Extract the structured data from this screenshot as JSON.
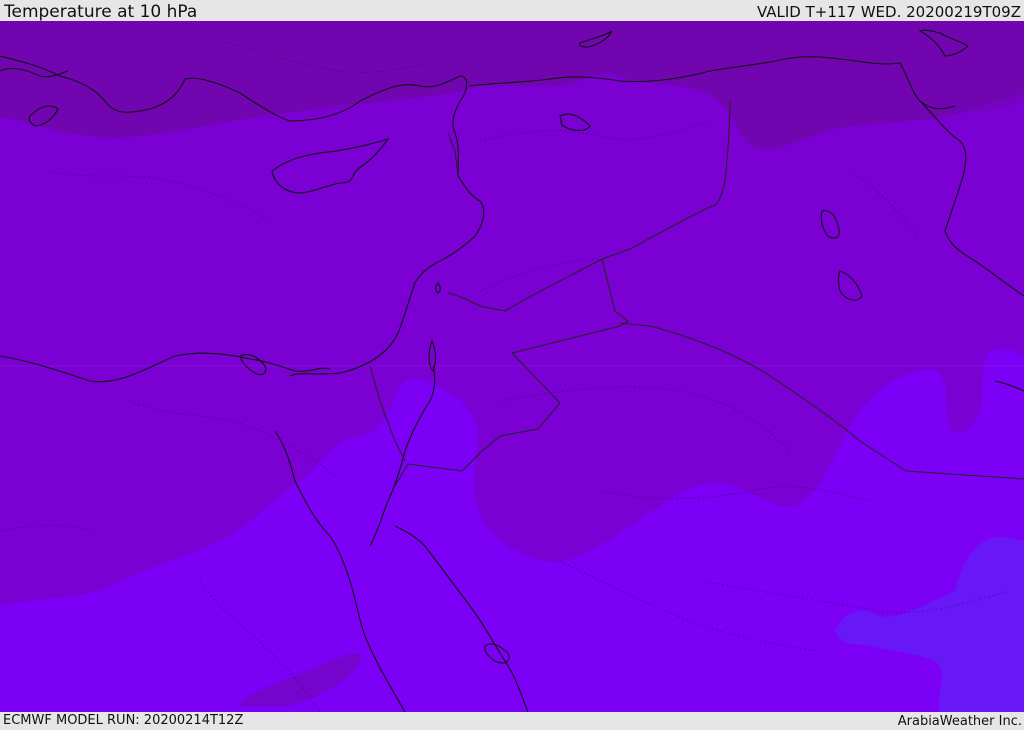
{
  "header": {
    "title": "Temperature at 10 hPa",
    "valid": "VALID T+117 WED. 20200219T09Z"
  },
  "footer": {
    "model_run": "ECMWF MODEL RUN: 20200214T12Z",
    "brand": "ArabiaWeather Inc."
  },
  "map": {
    "field": "temperature",
    "level": "10 hPa",
    "colors": {
      "band_warm": "#7106b1",
      "band_mid": "#7a00d3",
      "band_cool": "#7c00f5",
      "band_coldest": "#6818f7",
      "coastline": "#111111",
      "border": "#222222"
    }
  }
}
